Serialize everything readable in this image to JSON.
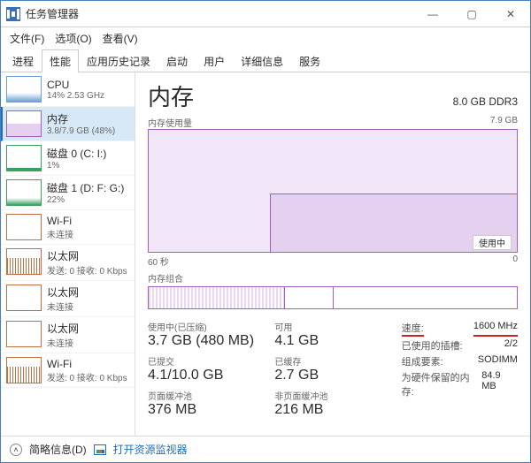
{
  "window": {
    "title": "任务管理器"
  },
  "menu": [
    "文件(F)",
    "选项(O)",
    "查看(V)"
  ],
  "tabs": [
    "进程",
    "性能",
    "应用历史记录",
    "启动",
    "用户",
    "详细信息",
    "服务"
  ],
  "active_tab": 1,
  "sidebar": [
    {
      "name": "CPU",
      "stat": "14% 2.53 GHz",
      "cls": "cpu"
    },
    {
      "name": "内存",
      "stat": "3.8/7.9 GB (48%)",
      "cls": "mem"
    },
    {
      "name": "磁盘 0 (C: I:)",
      "stat": "1%",
      "cls": "disk"
    },
    {
      "name": "磁盘 1 (D: F: G:)",
      "stat": "22%",
      "cls": "disk disk1"
    },
    {
      "name": "Wi-Fi",
      "stat": "未连接",
      "cls": "plain"
    },
    {
      "name": "以太网",
      "stat": "发送: 0 接收: 0 Kbps",
      "cls": "net"
    },
    {
      "name": "以太网",
      "stat": "未连接",
      "cls": "plain"
    },
    {
      "name": "以太网",
      "stat": "未连接",
      "cls": "plain"
    },
    {
      "name": "Wi-Fi",
      "stat": "发送: 0 接收: 0 Kbps",
      "cls": "net"
    }
  ],
  "sidebar_selected": 1,
  "main": {
    "heading": "内存",
    "capacity": "8.0 GB DDR3",
    "chart_label_top": "内存使用量",
    "chart_label_right": "7.9 GB",
    "chart_foot_left": "60 秒",
    "chart_tag": "使用中",
    "chart_foot_right": "0",
    "compo_label": "内存组合"
  },
  "stats_left": [
    {
      "lbl": "使用中(已压缩)",
      "val": "3.7 GB (480 MB)"
    },
    {
      "lbl": "已提交",
      "val": "4.1/10.0 GB"
    },
    {
      "lbl": "页面缓冲池",
      "val": "376 MB"
    }
  ],
  "stats_mid": [
    {
      "lbl": "可用",
      "val": "4.1 GB"
    },
    {
      "lbl": "已缓存",
      "val": "2.7 GB"
    },
    {
      "lbl": "非页面缓冲池",
      "val": "216 MB"
    }
  ],
  "stats_right": [
    {
      "k": "速度:",
      "v": "1600 MHz",
      "hl": true
    },
    {
      "k": "已使用的插槽:",
      "v": "2/2"
    },
    {
      "k": "组成要素:",
      "v": "SODIMM"
    },
    {
      "k": "为硬件保留的内存:",
      "v": "84.9 MB"
    }
  ],
  "footer": {
    "brief": "简略信息(D)",
    "link": "打开资源监视器"
  },
  "chart_data": {
    "type": "area",
    "title": "内存使用量",
    "ylabel": "GB",
    "ylim": [
      0,
      7.9
    ],
    "xlim_seconds": [
      60,
      0
    ],
    "series": [
      {
        "name": "使用中",
        "x_seconds_ago": [
          60,
          58,
          56,
          54,
          52,
          50,
          48,
          46,
          44,
          42,
          40,
          38,
          36,
          34,
          32,
          30,
          28,
          26,
          24,
          22,
          20,
          18,
          16,
          14,
          12,
          10,
          8,
          6,
          4,
          2,
          0
        ],
        "values_gb": [
          0,
          0,
          0,
          0,
          0,
          0,
          0,
          0,
          0,
          0,
          0,
          3.8,
          3.8,
          3.8,
          3.8,
          3.8,
          3.8,
          3.8,
          3.8,
          3.8,
          3.8,
          3.8,
          3.8,
          3.8,
          3.8,
          3.8,
          3.8,
          3.8,
          3.8,
          3.8,
          3.8
        ]
      }
    ]
  }
}
